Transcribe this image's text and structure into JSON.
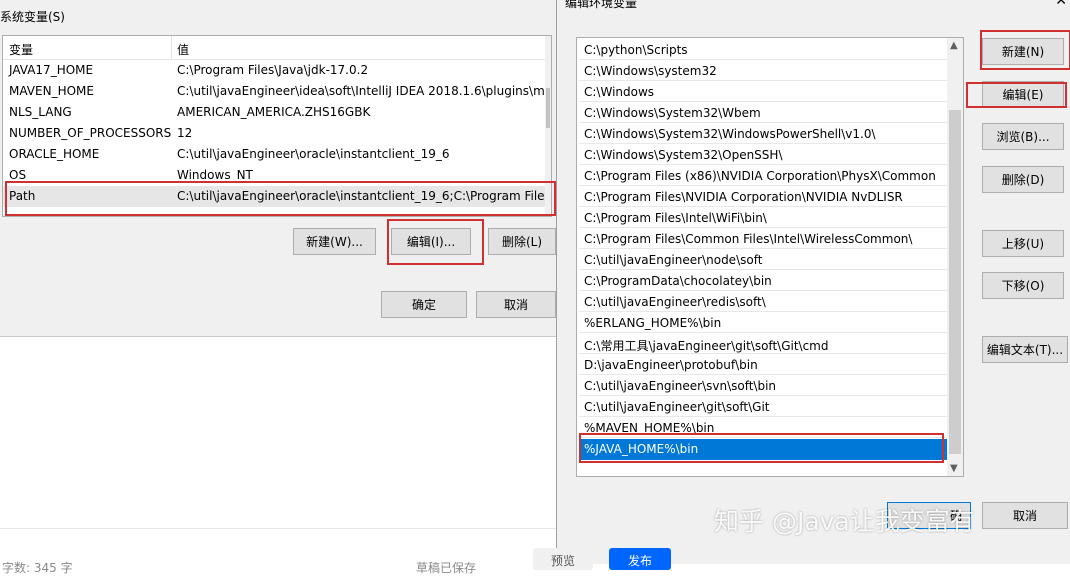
{
  "left_dialog": {
    "section_label": "系统变量(S)",
    "columns": {
      "name": "变量",
      "value": "值"
    },
    "variables": [
      {
        "name": "JAVA17_HOME",
        "value": "C:\\Program Files\\Java\\jdk-17.0.2"
      },
      {
        "name": "MAVEN_HOME",
        "value": "C:\\util\\javaEngineer\\idea\\soft\\IntelliJ IDEA 2018.1.6\\plugins\\m..."
      },
      {
        "name": "NLS_LANG",
        "value": "AMERICAN_AMERICA.ZHS16GBK"
      },
      {
        "name": "NUMBER_OF_PROCESSORS",
        "value": "12"
      },
      {
        "name": "ORACLE_HOME",
        "value": "C:\\util\\javaEngineer\\oracle\\instantclient_19_6"
      },
      {
        "name": "OS",
        "value": "Windows_NT"
      },
      {
        "name": "Path",
        "value": "C:\\util\\javaEngineer\\oracle\\instantclient_19_6;C:\\Program Files..."
      }
    ],
    "buttons": {
      "new": "新建(W)...",
      "edit": "编辑(I)...",
      "delete": "删除(L)"
    },
    "ok": "确定",
    "cancel": "取消"
  },
  "right_dialog": {
    "title": "编辑环境变量",
    "close": "✕",
    "paths": [
      "C:\\python\\Scripts",
      "C:\\Windows\\system32",
      "C:\\Windows",
      "C:\\Windows\\System32\\Wbem",
      "C:\\Windows\\System32\\WindowsPowerShell\\v1.0\\",
      "C:\\Windows\\System32\\OpenSSH\\",
      "C:\\Program Files (x86)\\NVIDIA Corporation\\PhysX\\Common",
      "C:\\Program Files\\NVIDIA Corporation\\NVIDIA NvDLISR",
      "C:\\Program Files\\Intel\\WiFi\\bin\\",
      "C:\\Program Files\\Common Files\\Intel\\WirelessCommon\\",
      "C:\\util\\javaEngineer\\node\\soft",
      "C:\\ProgramData\\chocolatey\\bin",
      "C:\\util\\javaEngineer\\redis\\soft\\",
      "%ERLANG_HOME%\\bin",
      "C:\\常用工具\\javaEngineer\\git\\soft\\Git\\cmd",
      "D:\\javaEngineer\\protobuf\\bin",
      "C:\\util\\javaEngineer\\svn\\soft\\bin",
      "C:\\util\\javaEngineer\\git\\soft\\Git",
      "%MAVEN_HOME%\\bin",
      "%JAVA_HOME%\\bin"
    ],
    "buttons": {
      "new": "新建(N)",
      "edit": "编辑(E)",
      "browse": "浏览(B)...",
      "delete": "删除(D)",
      "move_up": "上移(U)",
      "move_down": "下移(O)",
      "edit_text": "编辑文本(T)...",
      "ok_partial": "确",
      "cancel_partial": "取消"
    }
  },
  "editor": {
    "word_count": "字数: 345 字",
    "draft_saved": "草稿已保存",
    "preview": "预览",
    "publish": "发布"
  },
  "watermark": "知乎 @Java让我变富有",
  "colors": {
    "selection": "#0078d7",
    "highlight_box": "#d03030",
    "publish": "#0066ff"
  }
}
